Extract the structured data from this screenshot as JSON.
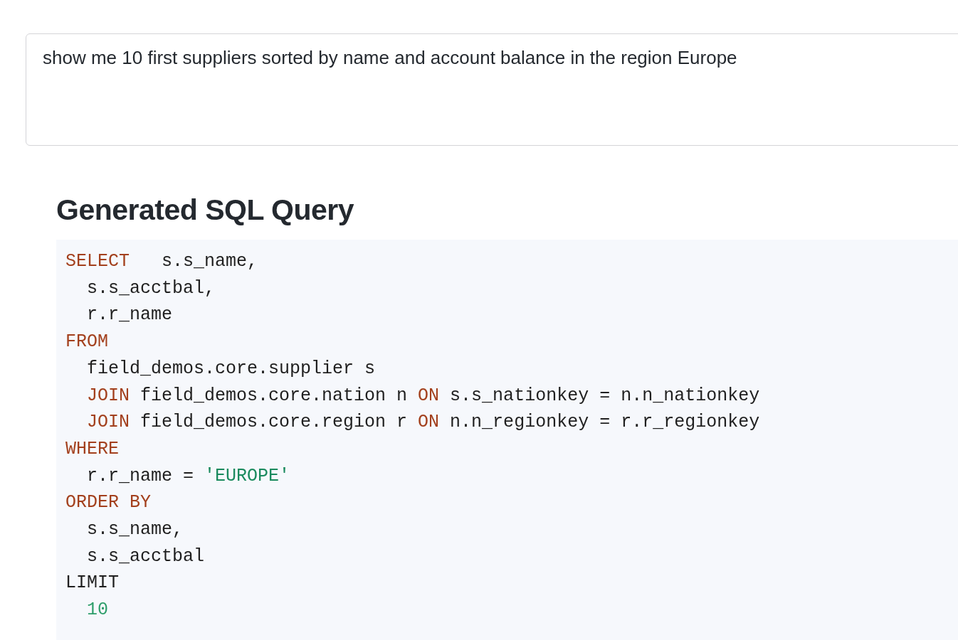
{
  "query_input": {
    "value": "show me 10 first suppliers sorted by name and account balance in the region Europe"
  },
  "heading": "Generated SQL Query",
  "sql_code": {
    "lines": [
      {
        "tokens": [
          {
            "kind": "keyword",
            "text": "SELECT"
          },
          {
            "kind": "plain",
            "text": "   s.s_name,"
          }
        ],
        "children": [
          {
            "tokens": [
              {
                "kind": "plain",
                "text": "s.s_acctbal,"
              }
            ]
          },
          {
            "tokens": [
              {
                "kind": "plain",
                "text": "r.r_name"
              }
            ]
          }
        ]
      },
      {
        "tokens": [
          {
            "kind": "keyword",
            "text": "FROM"
          }
        ],
        "children": [
          {
            "tokens": [
              {
                "kind": "plain",
                "text": "field_demos.core.supplier s"
              }
            ]
          },
          {
            "tokens": [
              {
                "kind": "keyword",
                "text": "JOIN"
              },
              {
                "kind": "plain",
                "text": " field_demos.core.nation n "
              },
              {
                "kind": "keyword",
                "text": "ON"
              },
              {
                "kind": "plain",
                "text": " s.s_nationkey = n.n_nationkey"
              }
            ]
          },
          {
            "tokens": [
              {
                "kind": "keyword",
                "text": "JOIN"
              },
              {
                "kind": "plain",
                "text": " field_demos.core.region r "
              },
              {
                "kind": "keyword",
                "text": "ON"
              },
              {
                "kind": "plain",
                "text": " n.n_regionkey = r.r_regionkey"
              }
            ]
          }
        ]
      },
      {
        "tokens": [
          {
            "kind": "keyword",
            "text": "WHERE"
          }
        ],
        "children": [
          {
            "tokens": [
              {
                "kind": "plain",
                "text": "r.r_name = "
              },
              {
                "kind": "string",
                "text": "'EUROPE'"
              }
            ]
          }
        ]
      },
      {
        "tokens": [
          {
            "kind": "keyword",
            "text": "ORDER BY"
          }
        ],
        "children": [
          {
            "tokens": [
              {
                "kind": "plain",
                "text": "s.s_name,"
              }
            ]
          },
          {
            "tokens": [
              {
                "kind": "plain",
                "text": "s.s_acctbal"
              }
            ]
          }
        ]
      },
      {
        "tokens": [
          {
            "kind": "plain",
            "text": "LIMIT"
          }
        ],
        "children": [
          {
            "tokens": [
              {
                "kind": "number",
                "text": "10"
              }
            ]
          }
        ]
      }
    ]
  }
}
